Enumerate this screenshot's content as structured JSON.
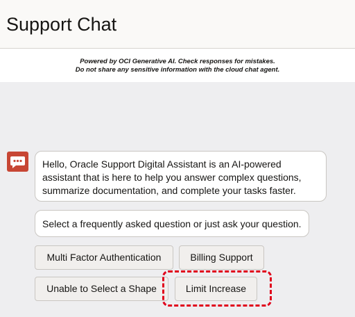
{
  "header": {
    "title": "Support Chat"
  },
  "disclaimer": {
    "line1": "Powered by OCI Generative AI. Check responses for mistakes.",
    "line2": "Do not share any sensitive information with the cloud chat agent."
  },
  "chat": {
    "avatar_icon": "chat-bubble-icon",
    "greeting_lines": [
      "Hello, Oracle Support Digital Assistant is an AI-powered",
      "assistant that is here to help you answer complex questions,",
      "summarize documentation, and complete your tasks faster."
    ],
    "prompt": "Select a frequently asked question or just ask your question.",
    "actions": [
      "Multi Factor Authentication",
      "Billing Support",
      "Unable to Select a Shape",
      "Limit Increase"
    ]
  },
  "colors": {
    "avatar": "#c74634",
    "highlight": "#e0001b",
    "background": "#eeeef0"
  }
}
